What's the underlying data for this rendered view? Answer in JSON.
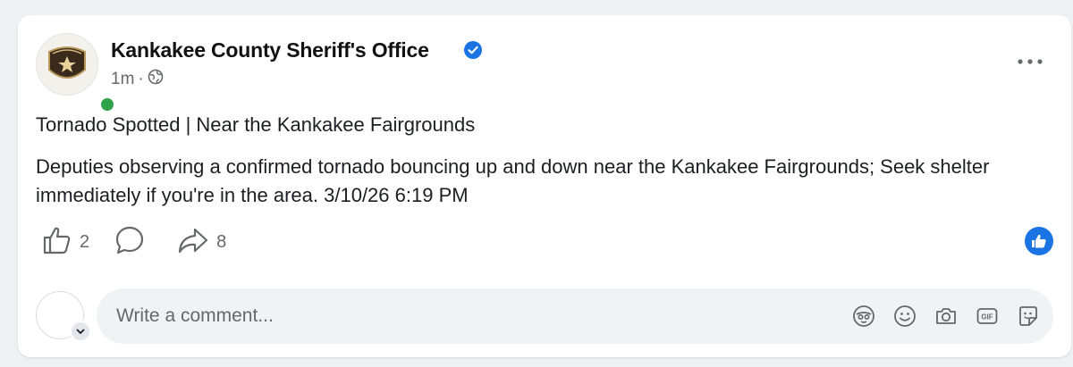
{
  "post": {
    "author": "Kankakee County Sheriff's Office",
    "timestamp": "1m",
    "separator": "·",
    "audience_icon": "globe-icon",
    "verified_icon": "verified-badge-icon",
    "title": "Tornado Spotted | Near the Kankakee Fairgrounds",
    "body": "Deputies observing a confirmed tornado bouncing up and down near the Kankakee Fairgrounds; Seek shelter immediately if you're in the area. 3/10/26 6:19 PM"
  },
  "actions": {
    "like_count": "2",
    "comment_count": "",
    "share_count": "8"
  },
  "comment": {
    "placeholder": "Write a comment..."
  },
  "colors": {
    "accent": "#1b74e4",
    "online": "#31a24c",
    "secondary_text": "#65676b"
  }
}
